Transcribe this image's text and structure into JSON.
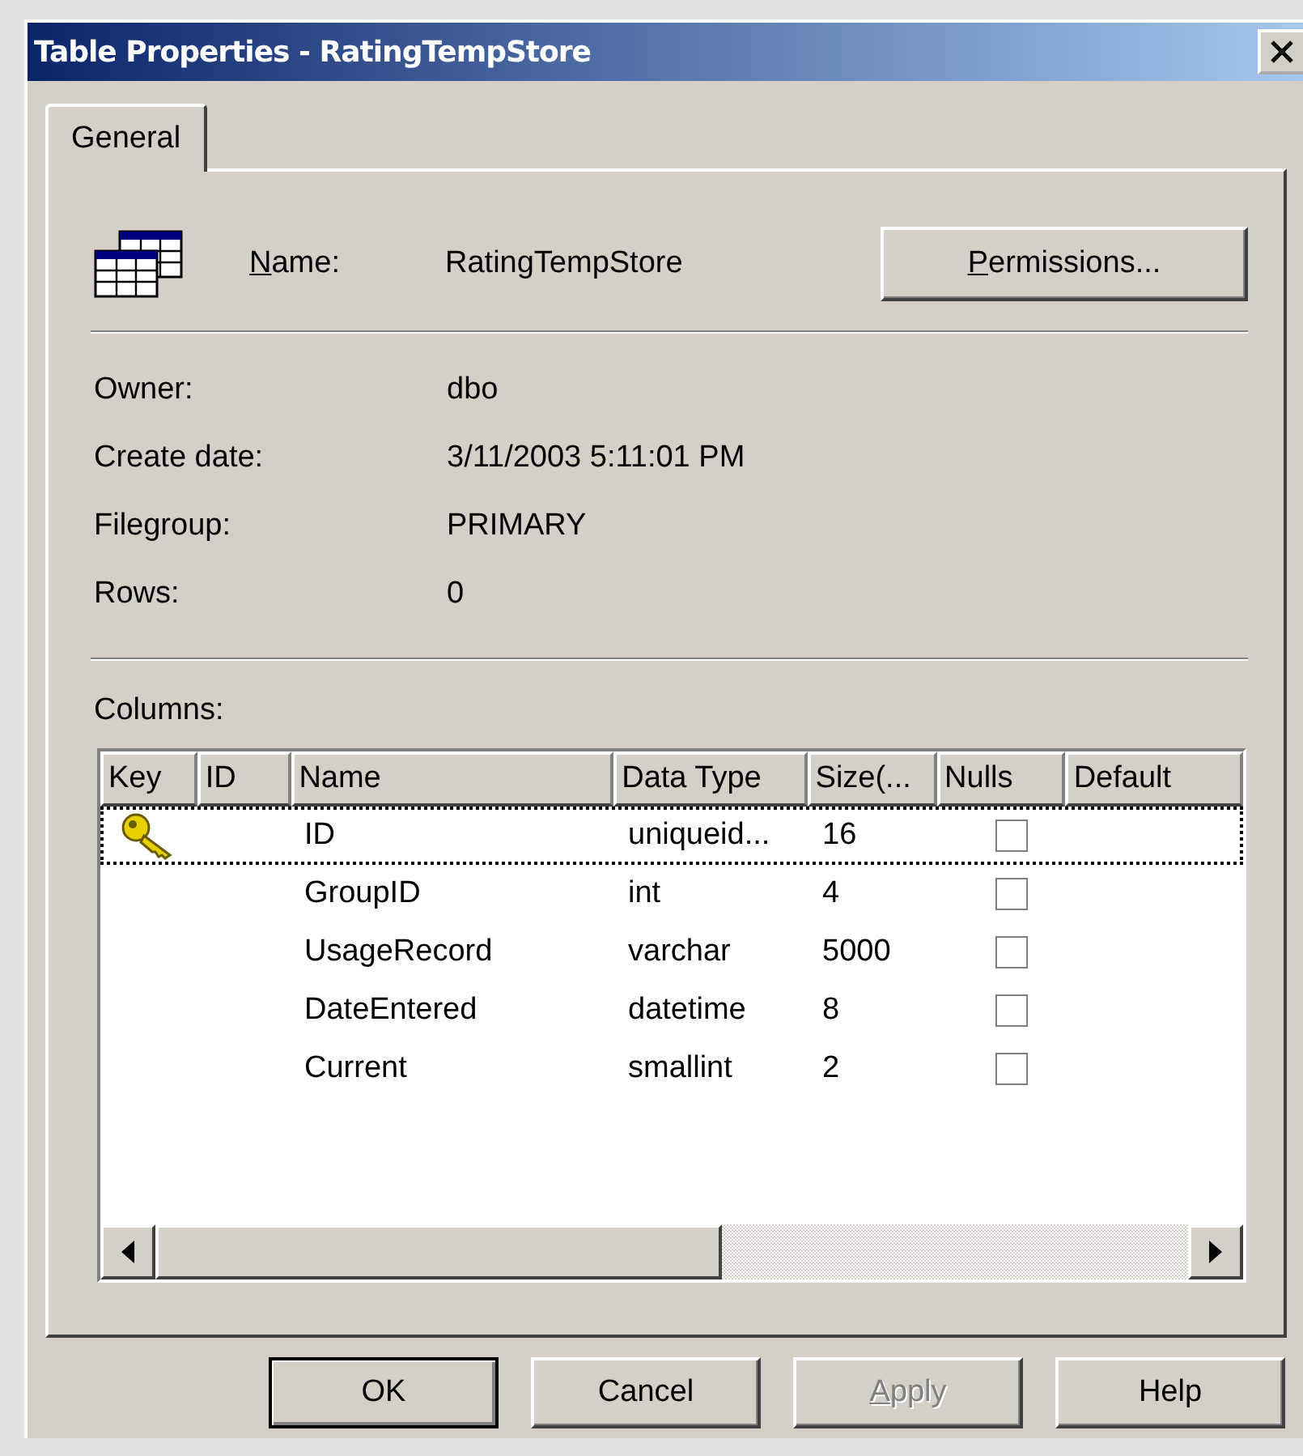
{
  "window": {
    "title": "Table Properties - RatingTempStore"
  },
  "tabs": [
    {
      "label": "General",
      "selected": true
    }
  ],
  "name_field": {
    "label": "Name:",
    "underline_first": true,
    "value": "RatingTempStore"
  },
  "permissions_button": {
    "label": "Permissions...",
    "underline_first": true
  },
  "properties": [
    {
      "label": "Owner:",
      "value": "dbo"
    },
    {
      "label": "Create date:",
      "value": "3/11/2003 5:11:01 PM"
    },
    {
      "label": "Filegroup:",
      "value": "PRIMARY"
    },
    {
      "label": "Rows:",
      "value": "0"
    }
  ],
  "columns_label": "Columns:",
  "table": {
    "columns": [
      "Key",
      "ID",
      "Name",
      "Data Type",
      "Size(...",
      "Nulls",
      "Default"
    ],
    "rows": [
      {
        "primary_key": true,
        "focused": true,
        "name": "ID",
        "data_type": "uniqueid...",
        "size": "16",
        "nulls": false
      },
      {
        "primary_key": false,
        "focused": false,
        "name": "GroupID",
        "data_type": "int",
        "size": "4",
        "nulls": false
      },
      {
        "primary_key": false,
        "focused": false,
        "name": "UsageRecord",
        "data_type": "varchar",
        "size": "5000",
        "nulls": false
      },
      {
        "primary_key": false,
        "focused": false,
        "name": "DateEntered",
        "data_type": "datetime",
        "size": "8",
        "nulls": false
      },
      {
        "primary_key": false,
        "focused": false,
        "name": "Current",
        "data_type": "smallint",
        "size": "2",
        "nulls": false
      }
    ]
  },
  "buttons": [
    {
      "label": "OK",
      "default": true,
      "disabled": false,
      "underline_first": false
    },
    {
      "label": "Cancel",
      "default": false,
      "disabled": false,
      "underline_first": false
    },
    {
      "label": "Apply",
      "default": false,
      "disabled": true,
      "underline_first": true
    },
    {
      "label": "Help",
      "default": false,
      "disabled": false,
      "underline_first": false
    }
  ]
}
